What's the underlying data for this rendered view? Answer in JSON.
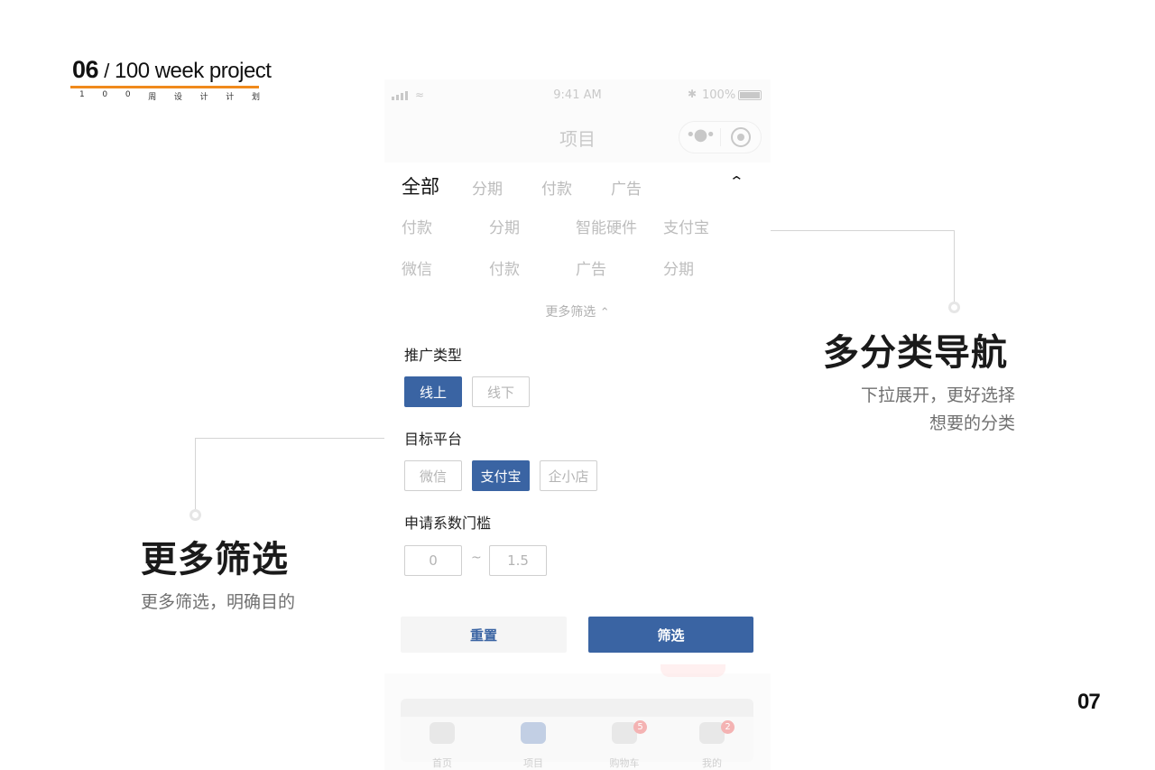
{
  "brand": {
    "number": "06",
    "slash": "/",
    "title": "100 week project",
    "subtitle_chars": [
      "1",
      "0",
      "0",
      "周",
      "设",
      "计",
      "计",
      "划"
    ],
    "underline_color": "#f08a1c"
  },
  "page_number": "07",
  "phone": {
    "status": {
      "time": "9:41 AM",
      "battery": "100%",
      "bluetooth_icon": "bluetooth-icon",
      "wifi_icon": "wifi-icon"
    },
    "nav": {
      "title": "项目",
      "more_icon": "more-dots-icon",
      "close_icon": "target-circle-icon"
    },
    "tabs": [
      "全部",
      "分期",
      "付款",
      "广告"
    ],
    "active_tab": "全部",
    "categories": [
      [
        "付款",
        "分期",
        "智能硬件",
        "支付宝"
      ],
      [
        "微信",
        "付款",
        "广告",
        "分期"
      ]
    ],
    "more_filter": "更多筛选",
    "sections": {
      "promo_type": {
        "label": "推广类型",
        "options": [
          "线上",
          "线下"
        ],
        "selected": "线上"
      },
      "platform": {
        "label": "目标平台",
        "options": [
          "微信",
          "支付宝",
          "企小店"
        ],
        "selected": "支付宝"
      },
      "threshold": {
        "label": "申请系数门槛",
        "min": "0",
        "max": "1.5",
        "separator": "~"
      }
    },
    "buttons": {
      "reset": "重置",
      "filter": "筛选"
    },
    "tabbar": [
      {
        "label": "首页",
        "badge": ""
      },
      {
        "label": "项目",
        "badge": ""
      },
      {
        "label": "购物车",
        "badge": "5"
      },
      {
        "label": "我的",
        "badge": "2"
      }
    ],
    "accent_color": "#3a64a3"
  },
  "annotations": {
    "right": {
      "title": "多分类导航",
      "desc_lines": [
        "下拉展开，更好选择",
        "想要的分类"
      ]
    },
    "left": {
      "title": "更多筛选",
      "desc": "更多筛选，明确目的"
    }
  }
}
